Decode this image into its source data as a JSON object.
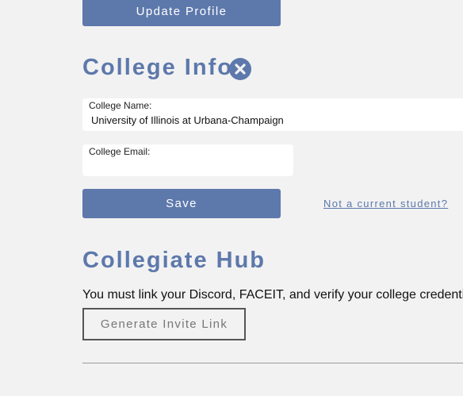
{
  "profile": {
    "update_button_label": "Update Profile"
  },
  "college_info": {
    "title": "College Info",
    "close_icon": "close-circle-icon",
    "college_name": {
      "label": "College Name:",
      "value": "University of Illinois at Urbana-Champaign"
    },
    "college_email": {
      "label": "College Email:",
      "value": ""
    },
    "save_label": "Save",
    "not_student_link": "Not a current student?"
  },
  "collegiate_hub": {
    "title": "Collegiate Hub",
    "message": "You must link your Discord, FACEIT, and verify your college credentia",
    "generate_button_label": "Generate Invite Link"
  },
  "colors": {
    "accent": "#5d78ab",
    "background": "#f2f2f2",
    "field_background": "#ffffff"
  }
}
